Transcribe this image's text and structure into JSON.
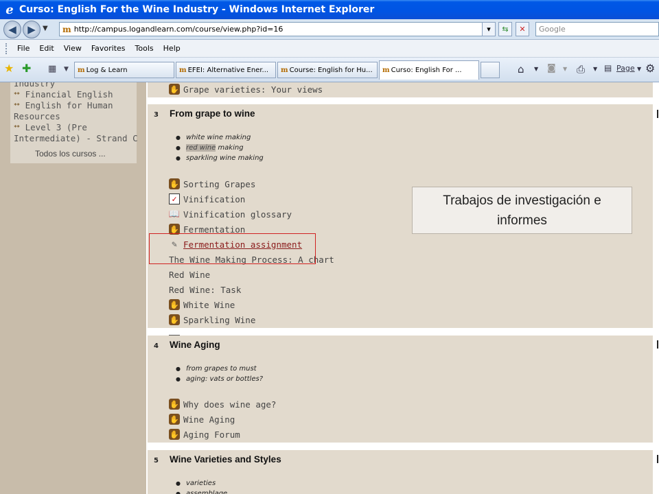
{
  "window": {
    "title": "Curso: English For the Wine Industry - Windows Internet Explorer"
  },
  "address_bar": {
    "url": "http://campus.logandlearn.com/course/view.php?id=16",
    "search_placeholder": "Google"
  },
  "menu": [
    "File",
    "Edit",
    "View",
    "Favorites",
    "Tools",
    "Help"
  ],
  "tabs": [
    {
      "label": "Log & Learn"
    },
    {
      "label": "EFEI: Alternative Ener..."
    },
    {
      "label": "Course: English for Hu..."
    },
    {
      "label": "Curso: English For ..."
    }
  ],
  "toolbar_right": {
    "page_label": "Page"
  },
  "sidebar": {
    "lines": [
      {
        "text": "Industry",
        "icon": false
      },
      {
        "text": "Financial English",
        "icon": true
      },
      {
        "text": "English for Human",
        "icon": true
      },
      {
        "text": "Resources",
        "icon": false
      },
      {
        "text": "Level 3 (Pre",
        "icon": true
      },
      {
        "text": "Intermediate) - Strand C",
        "icon": false
      }
    ],
    "all_courses": "Todos los cursos ..."
  },
  "top_activity": {
    "label": "Grape varieties: Your views",
    "icon": "forum-icon"
  },
  "sections": [
    {
      "number": "3",
      "title": "From grape to wine",
      "bullets": [
        {
          "text": "white wine making"
        },
        {
          "highlight": "red wine",
          "text": " making"
        },
        {
          "text": "sparkling wine making"
        }
      ],
      "activities": [
        {
          "label": "Sorting Grapes",
          "icon": "forum-icon",
          "link": false
        },
        {
          "label": "Vinification",
          "icon": "quiz-icon",
          "link": false
        },
        {
          "label": "Vinification glossary",
          "icon": "glossary-icon",
          "link": false
        },
        {
          "label": "Fermentation",
          "icon": "forum-icon",
          "link": false
        },
        {
          "label": "Fermentation assignment",
          "icon": "assignment-icon",
          "link": true
        },
        {
          "label": "The Wine Making Process: A chart",
          "icon": "page-icon",
          "link": false
        },
        {
          "label": "Red Wine",
          "icon": "page-icon",
          "link": false
        },
        {
          "label": "Red Wine: Task",
          "icon": "page-icon",
          "link": false
        },
        {
          "label": "White Wine",
          "icon": "forum-icon",
          "link": false
        },
        {
          "label": "Sparkling Wine",
          "icon": "forum-icon",
          "link": false
        }
      ]
    },
    {
      "number": "4",
      "title": "Wine Aging",
      "bullets": [
        {
          "text": "from grapes to must"
        },
        {
          "text": "aging: vats or bottles?"
        }
      ],
      "activities": [
        {
          "label": "Why does wine age?",
          "icon": "forum-icon",
          "link": false
        },
        {
          "label": "Wine Aging",
          "icon": "forum-icon",
          "link": false
        },
        {
          "label": "Aging Forum",
          "icon": "forum-icon",
          "link": false
        }
      ]
    },
    {
      "number": "5",
      "title": "Wine Varieties and Styles",
      "bullets": [
        {
          "text": "varieties"
        },
        {
          "text": "assemblage"
        }
      ]
    }
  ],
  "callout": {
    "line1": "Trabajos de investigación e",
    "line2": "informes"
  },
  "colors": {
    "title_bar": "#0054e3",
    "section_bg": "#e2dacd",
    "sidebar_bg": "#c8bcaa",
    "highlight_box": "#d02020"
  }
}
